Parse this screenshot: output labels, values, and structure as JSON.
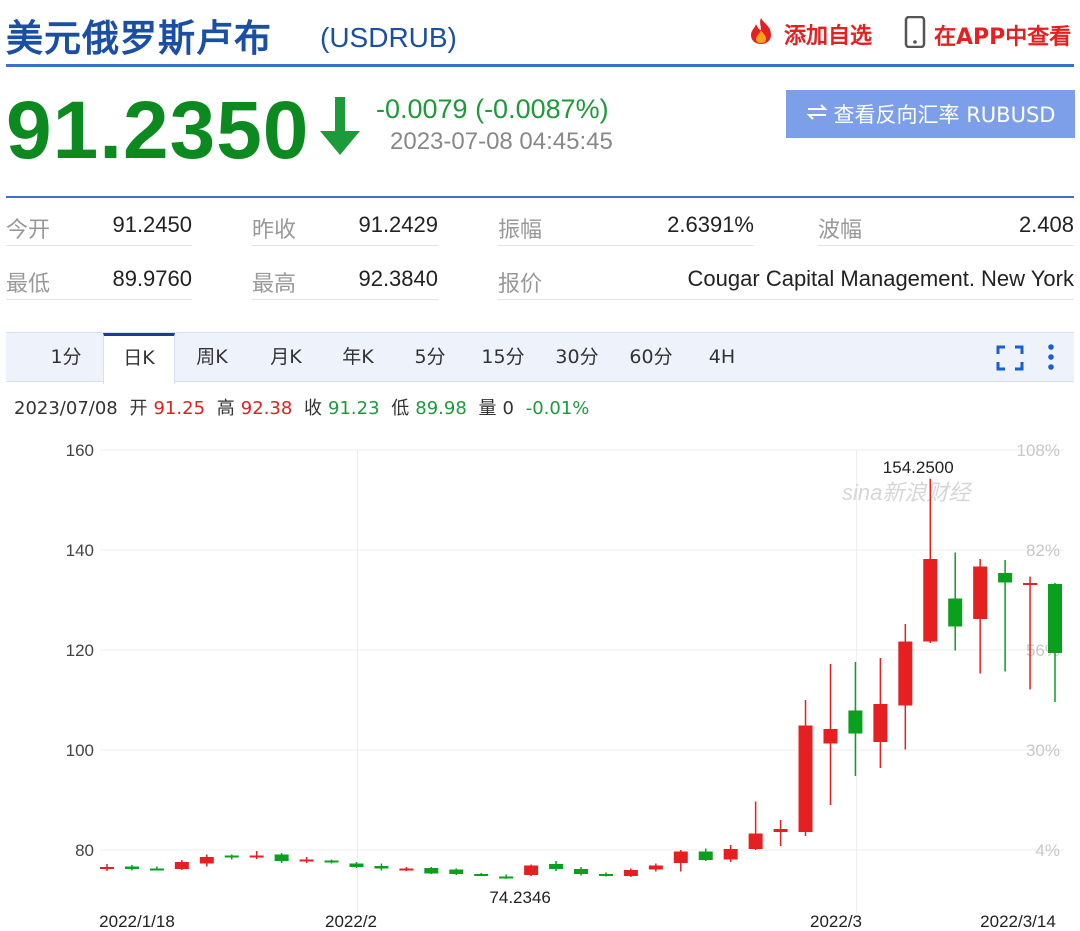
{
  "header": {
    "title": "美元俄罗斯卢布",
    "symbol": "(USDRUB)",
    "add_favorite": "添加自选",
    "view_in_app": "在APP中查看"
  },
  "quote": {
    "price": "91.2350",
    "direction": "down",
    "change": "-0.0079 (-0.0087%)",
    "timestamp": "2023-07-08 04:45:45",
    "reverse_button": "查看反向汇率 RUBUSD"
  },
  "stats": [
    {
      "label": "今开",
      "value": "91.2450"
    },
    {
      "label": "昨收",
      "value": "91.2429"
    },
    {
      "label": "振幅",
      "value": "2.6391%"
    },
    {
      "label": "波幅",
      "value": "2.408"
    },
    {
      "label": "最低",
      "value": "89.9760"
    },
    {
      "label": "最高",
      "value": "92.3840"
    },
    {
      "label": "报价",
      "value": "Cougar Capital Management. New York"
    }
  ],
  "tabs": [
    "1分",
    "日K",
    "周K",
    "月K",
    "年K",
    "5分",
    "15分",
    "30分",
    "60分",
    "4H"
  ],
  "active_tab": "日K",
  "ohlc": {
    "date": "2023/07/08",
    "open_label": "开",
    "open": "91.25",
    "high_label": "高",
    "high": "92.38",
    "close_label": "收",
    "close": "91.23",
    "low_label": "低",
    "low": "89.98",
    "volume_label": "量",
    "volume": "0",
    "change_pct": "-0.01%"
  },
  "colors": {
    "up": "#e62020",
    "down": "#0aa01e",
    "title_blue": "#1a4fa3",
    "button_blue": "#7d9ee8"
  },
  "chart_data": {
    "type": "candlestick",
    "ylim": [
      70,
      160
    ],
    "y_ticks": [
      80,
      100,
      120,
      140,
      160
    ],
    "right_ticks": [
      "108%",
      "82%",
      "56%",
      "30%",
      "4%"
    ],
    "x_labels": [
      "2022/1/18",
      "2022/2",
      "2022/3",
      "2022/3/14"
    ],
    "max_label": "154.2500",
    "min_label": "74.2346",
    "watermark": "sina新浪财经",
    "candles": [
      {
        "o": 76.4,
        "h": 77.2,
        "l": 75.8,
        "c": 76.6
      },
      {
        "o": 76.7,
        "h": 77.0,
        "l": 75.9,
        "c": 76.2
      },
      {
        "o": 76.3,
        "h": 76.7,
        "l": 75.9,
        "c": 76.1
      },
      {
        "o": 76.2,
        "h": 78.0,
        "l": 76.0,
        "c": 77.6
      },
      {
        "o": 77.3,
        "h": 79.1,
        "l": 76.7,
        "c": 78.6
      },
      {
        "o": 78.9,
        "h": 79.1,
        "l": 78.1,
        "c": 78.6
      },
      {
        "o": 78.5,
        "h": 79.8,
        "l": 78.2,
        "c": 78.9
      },
      {
        "o": 79.1,
        "h": 79.4,
        "l": 77.4,
        "c": 77.8
      },
      {
        "o": 77.9,
        "h": 78.6,
        "l": 77.4,
        "c": 78.1
      },
      {
        "o": 77.9,
        "h": 78.1,
        "l": 77.3,
        "c": 77.5
      },
      {
        "o": 77.3,
        "h": 77.6,
        "l": 76.4,
        "c": 76.6
      },
      {
        "o": 76.8,
        "h": 77.3,
        "l": 75.9,
        "c": 76.3
      },
      {
        "o": 76.2,
        "h": 76.6,
        "l": 75.8,
        "c": 76.3
      },
      {
        "o": 76.4,
        "h": 76.6,
        "l": 75.2,
        "c": 75.3
      },
      {
        "o": 76.1,
        "h": 76.3,
        "l": 75.0,
        "c": 75.2
      },
      {
        "o": 75.2,
        "h": 75.4,
        "l": 74.8,
        "c": 74.9
      },
      {
        "o": 74.7,
        "h": 75.1,
        "l": 74.23,
        "c": 74.5
      },
      {
        "o": 75.0,
        "h": 77.1,
        "l": 74.8,
        "c": 76.9
      },
      {
        "o": 77.2,
        "h": 77.8,
        "l": 75.8,
        "c": 76.2
      },
      {
        "o": 76.2,
        "h": 76.6,
        "l": 74.9,
        "c": 75.2
      },
      {
        "o": 75.2,
        "h": 75.5,
        "l": 74.7,
        "c": 74.9
      },
      {
        "o": 74.8,
        "h": 76.3,
        "l": 74.6,
        "c": 76.0
      },
      {
        "o": 76.1,
        "h": 77.3,
        "l": 75.7,
        "c": 76.9
      },
      {
        "o": 77.4,
        "h": 80.0,
        "l": 75.7,
        "c": 79.7
      },
      {
        "o": 79.7,
        "h": 80.3,
        "l": 77.8,
        "c": 78.0
      },
      {
        "o": 78.1,
        "h": 81.0,
        "l": 77.6,
        "c": 80.2
      },
      {
        "o": 80.2,
        "h": 89.7,
        "l": 80.0,
        "c": 83.3
      },
      {
        "o": 83.6,
        "h": 86.0,
        "l": 80.8,
        "c": 84.2
      },
      {
        "o": 83.6,
        "h": 110.0,
        "l": 82.8,
        "c": 104.9
      },
      {
        "o": 101.3,
        "h": 117.2,
        "l": 89.0,
        "c": 104.2
      },
      {
        "o": 107.9,
        "h": 117.6,
        "l": 94.8,
        "c": 103.3
      },
      {
        "o": 101.6,
        "h": 118.4,
        "l": 96.4,
        "c": 109.2
      },
      {
        "o": 108.9,
        "h": 125.2,
        "l": 100.1,
        "c": 121.7
      },
      {
        "o": 121.7,
        "h": 154.25,
        "l": 121.4,
        "c": 138.2
      },
      {
        "o": 130.3,
        "h": 139.5,
        "l": 119.9,
        "c": 124.7
      },
      {
        "o": 126.2,
        "h": 138.2,
        "l": 115.3,
        "c": 136.7
      },
      {
        "o": 135.4,
        "h": 138.0,
        "l": 115.7,
        "c": 133.5
      },
      {
        "o": 133.0,
        "h": 134.7,
        "l": 112.1,
        "c": 133.4
      },
      {
        "o": 133.2,
        "h": 133.4,
        "l": 109.6,
        "c": 119.4
      }
    ]
  }
}
